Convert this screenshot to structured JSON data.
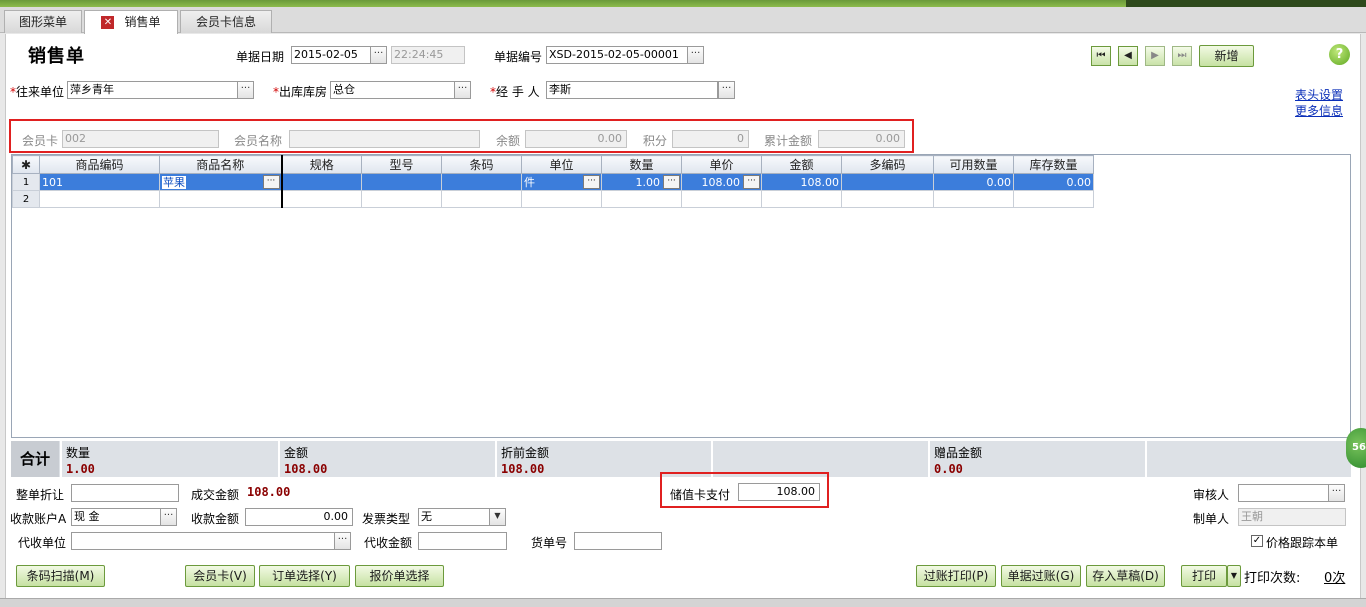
{
  "tabs": [
    {
      "label": "图形菜单"
    },
    {
      "label": "销售单"
    },
    {
      "label": "会员卡信息"
    }
  ],
  "header": {
    "title": "销售单",
    "date_label": "单据日期",
    "date_value": "2015-02-05",
    "time_value": "22:24:45",
    "docno_label": "单据编号",
    "docno_value": "XSD-2015-02-05-00001",
    "new_button": "新增",
    "help_icon": "?"
  },
  "nav": {
    "first": "⏮",
    "prev": "◀",
    "next": "▶",
    "last": "⏭"
  },
  "row1": {
    "partner_label": "往来单位",
    "partner_value": "萍乡青年",
    "warehouse_label": "出库库房",
    "warehouse_value": "总仓",
    "handler_label": "经 手 人",
    "handler_value": "李斯",
    "link_header_settings": "表头设置",
    "link_more_info": "更多信息"
  },
  "member": {
    "card_label": "会员卡",
    "card_value": "002",
    "name_label": "会员名称",
    "name_value": "",
    "balance_label": "余额",
    "balance_value": "0.00",
    "points_label": "积分",
    "points_value": "0",
    "total_label": "累计金额",
    "total_value": "0.00"
  },
  "grid": {
    "columns": [
      "✱",
      "商品编码",
      "商品名称",
      "规格",
      "型号",
      "条码",
      "单位",
      "数量",
      "单价",
      "金额",
      "多编码",
      "可用数量",
      "库存数量"
    ],
    "rows": [
      [
        "1",
        "101",
        "苹果",
        "",
        "",
        "",
        "件",
        "1.00",
        "108.00",
        "108.00",
        "",
        "0.00",
        "0.00"
      ],
      [
        "2",
        "",
        "",
        "",
        "",
        "",
        "",
        "",
        "",
        "",
        "",
        "",
        ""
      ]
    ]
  },
  "totals": {
    "label": "合计",
    "qty_label": "数量",
    "qty_value": "1.00",
    "amount_label": "金额",
    "amount_value": "108.00",
    "pre_discount_label": "折前金额",
    "pre_discount_value": "108.00",
    "gift_label": "赠品金额",
    "gift_value": "0.00"
  },
  "footer": {
    "discount_label": "整单折让",
    "discount_value": "",
    "deal_label": "成交金额",
    "deal_value": "108.00",
    "stored_card_label": "储值卡支付",
    "stored_card_value": "108.00",
    "auditor_label": "审核人",
    "auditor_value": "",
    "account_label": "收款账户A",
    "account_value": "现    金",
    "receive_label": "收款金额",
    "receive_value": "0.00",
    "invoice_label": "发票类型",
    "invoice_value": "无",
    "maker_label": "制单人",
    "maker_value": "王朝",
    "agent_label": "代收单位",
    "agent_value": "",
    "agent_amount_label": "代收金额",
    "agent_amount_value": "",
    "waybill_label": "货单号",
    "waybill_value": "",
    "price_track_label": "价格跟踪本单",
    "price_track_checked": "✓"
  },
  "buttons": {
    "barcode": "条码扫描(M)",
    "member_card": "会员卡(V)",
    "order_select": "订单选择(Y)",
    "quote_select": "报价单选择",
    "post_print": "过账打印(P)",
    "post": "单据过账(G)",
    "save_draft": "存入草稿(D)",
    "print": "打印",
    "print_count_label": "打印次数:",
    "print_count_value": "0次"
  },
  "side_badge": "56",
  "colors": {
    "accent_green": "#c6e1a2",
    "selection_blue": "#3c7ddb",
    "value_red": "#8a0000",
    "highlight_box": "#e02020"
  }
}
